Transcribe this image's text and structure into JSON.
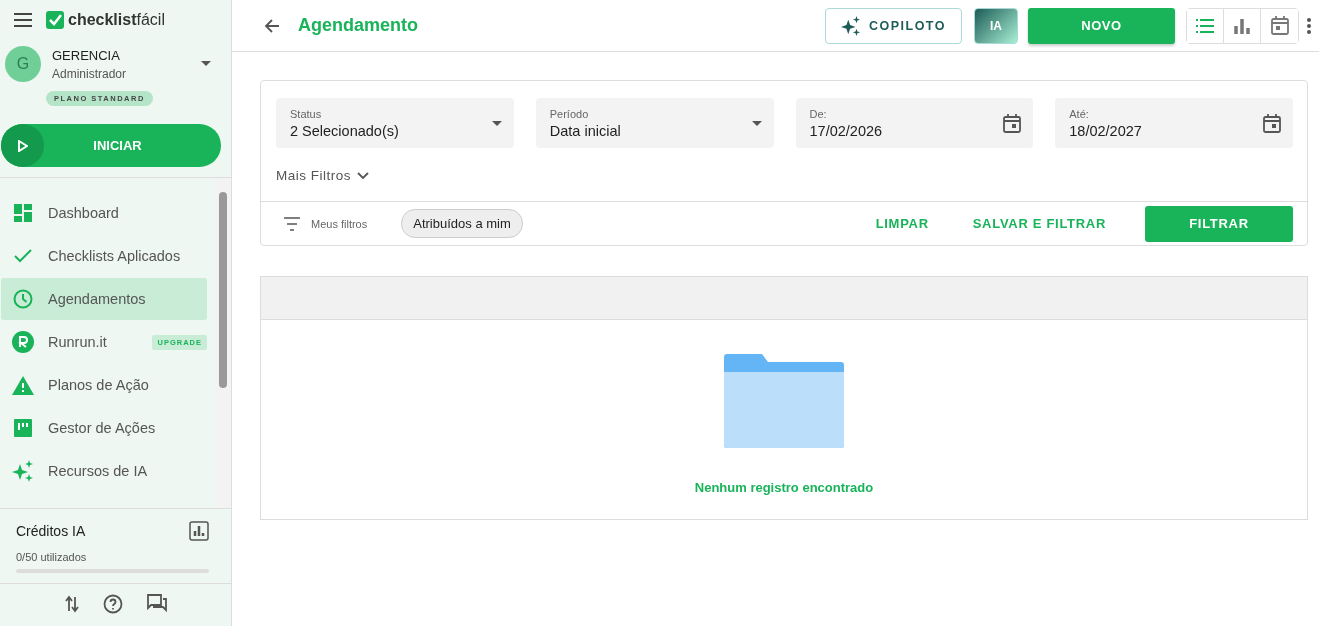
{
  "sidebar": {
    "brand": {
      "name_bold": "checklist",
      "name_light": "fácil"
    },
    "user": {
      "initial": "G",
      "name": "GERENCIA",
      "role": "Administrador",
      "plan": "PLANO STANDARD"
    },
    "start_button": "INICIAR",
    "items": [
      {
        "kind": "dashboard",
        "label": "Dashboard",
        "selected": false
      },
      {
        "kind": "check",
        "label": "Checklists Aplicados",
        "selected": false
      },
      {
        "kind": "clock",
        "label": "Agendamentos",
        "selected": true
      },
      {
        "kind": "runrun",
        "label": "Runrun.it",
        "selected": false,
        "badge": "UPGRADE"
      },
      {
        "kind": "warning",
        "label": "Planos de Ação",
        "selected": false
      },
      {
        "kind": "board",
        "label": "Gestor de Ações",
        "selected": false
      },
      {
        "kind": "sparkle",
        "label": "Recursos de IA",
        "selected": false
      }
    ],
    "credits": {
      "title": "Créditos IA",
      "usage": "0/50 utilizados",
      "level": 0
    }
  },
  "header": {
    "title": "Agendamento",
    "copilot": "COPILOTO",
    "ia": "IA",
    "new": "NOVO",
    "views": [
      {
        "kind": "list",
        "selected": true
      },
      {
        "kind": "chart",
        "selected": false
      },
      {
        "kind": "calendar",
        "selected": false
      }
    ]
  },
  "filters": {
    "fields": [
      {
        "kind": "select",
        "label": "Status",
        "value": "2 Selecionado(s)"
      },
      {
        "kind": "select",
        "label": "Período",
        "value": "Data inicial"
      },
      {
        "kind": "date",
        "label": "De:",
        "value": "17/02/2026"
      },
      {
        "kind": "date",
        "label": "Até:",
        "value": "18/02/2027"
      }
    ],
    "more": "Mais Filtros",
    "my_filters": "Meus filtros",
    "chip": "Atribuídos a mim",
    "clear": "LIMPAR",
    "save": "SALVAR E FILTRAR",
    "apply": "FILTRAR"
  },
  "results": {
    "empty": "Nenhum registro encontrado"
  }
}
